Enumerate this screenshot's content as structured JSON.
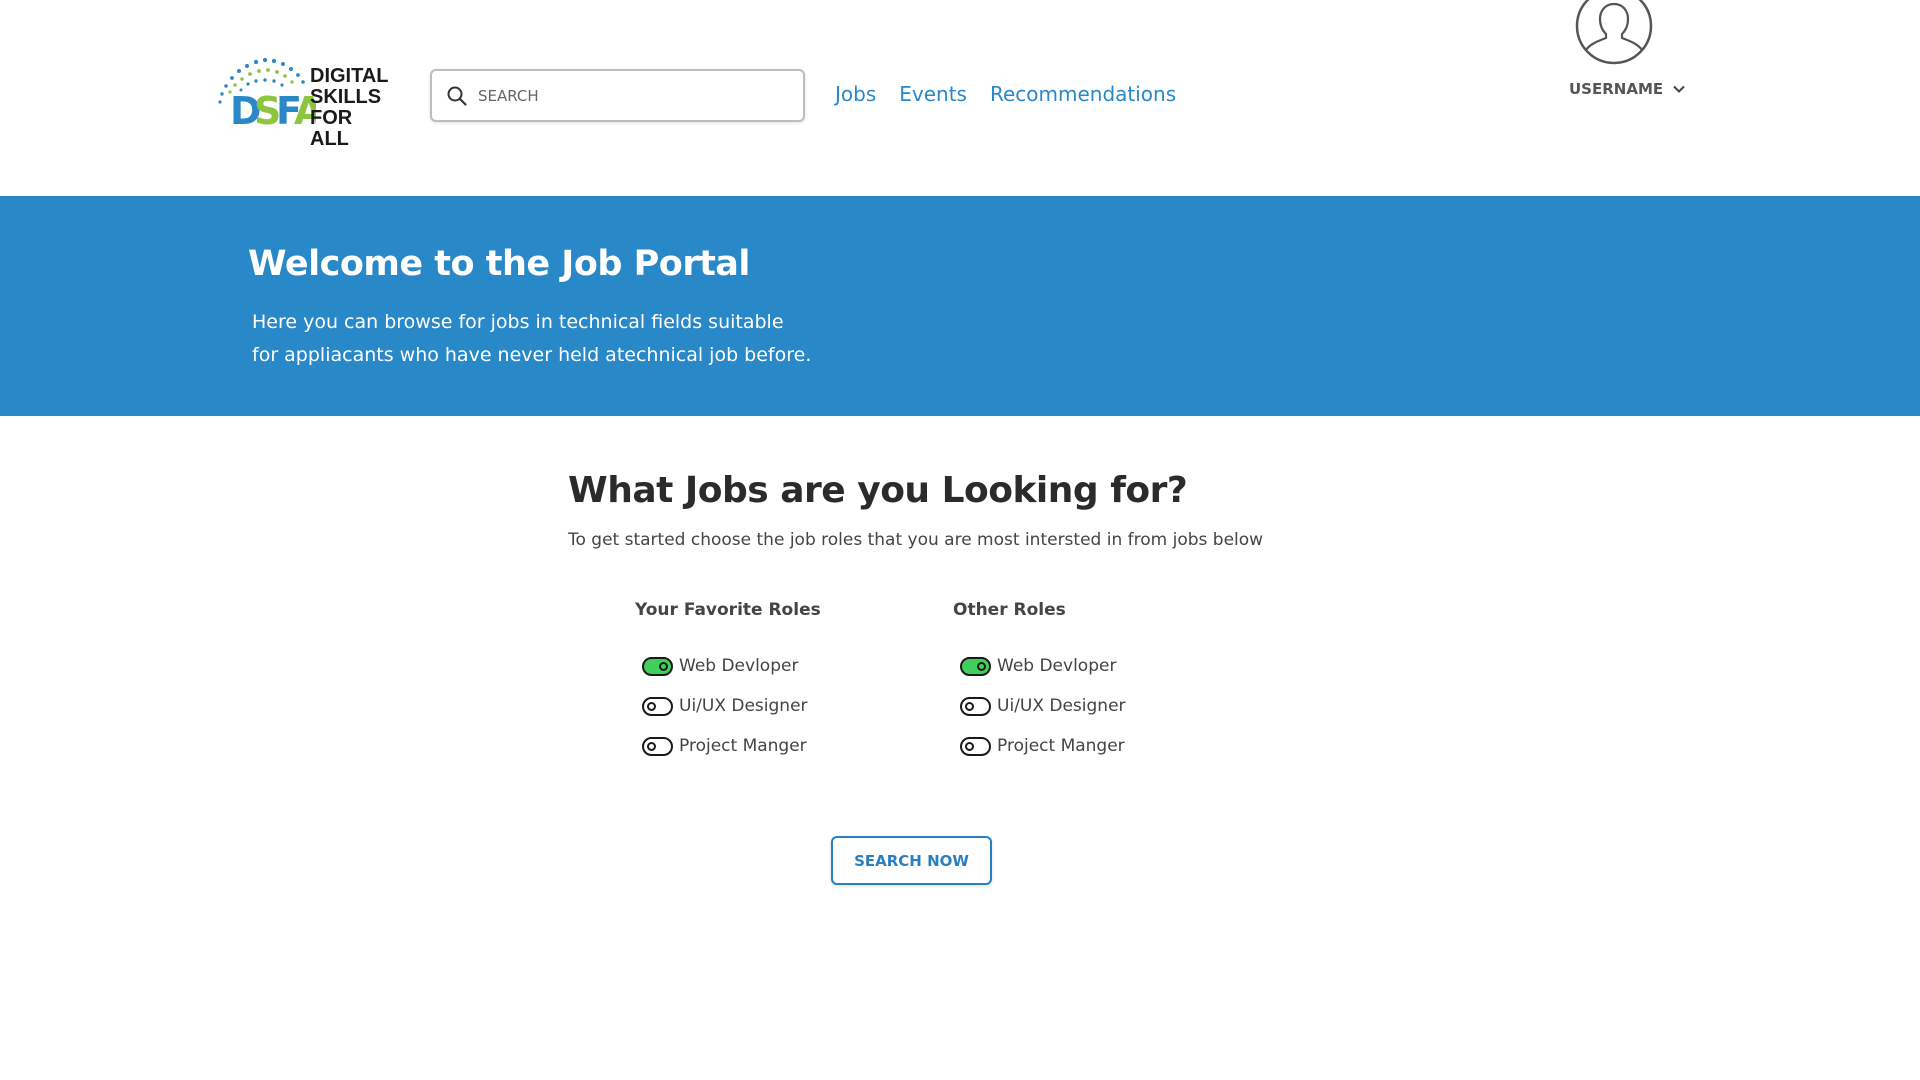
{
  "brand": {
    "logo_letters": "DSFA",
    "logo_lines": [
      "DIGITAL",
      "SKILLS",
      "FOR ALL"
    ],
    "colors": {
      "blue": "#2a88c8",
      "green": "#8cc63f",
      "dark": "#1a1a1a"
    }
  },
  "header": {
    "search_placeholder": "SEARCH",
    "nav": [
      "Jobs",
      "Events",
      "Recommendations"
    ],
    "username": "USERNAME",
    "icons": {
      "search": "search-icon",
      "avatar": "user-avatar-icon",
      "dropdown": "chevron-down-icon"
    }
  },
  "hero": {
    "title": "Welcome to the Job Portal",
    "subtitle_line1": "Here you can browse for jobs in technical fields suitable",
    "subtitle_line2": "for appliacants who have never held atechnical job before.",
    "background": "#2888c8"
  },
  "main": {
    "title": "What Jobs are you Looking for?",
    "subtitle": "To get started choose the job roles that you are most intersted in from jobs below",
    "favorite_roles": {
      "heading": "Your Favorite Roles",
      "items": [
        {
          "label": "Web Devloper",
          "on": true
        },
        {
          "label": "Ui/UX Designer",
          "on": false
        },
        {
          "label": "Project Manger",
          "on": false
        }
      ]
    },
    "other_roles": {
      "heading": "Other Roles",
      "items": [
        {
          "label": "Web Devloper",
          "on": true
        },
        {
          "label": "Ui/UX Designer",
          "on": false
        },
        {
          "label": "Project Manger",
          "on": false
        }
      ]
    },
    "button_label": "SEARCH NOW",
    "toggle_on_color": "#3fcf5a"
  }
}
